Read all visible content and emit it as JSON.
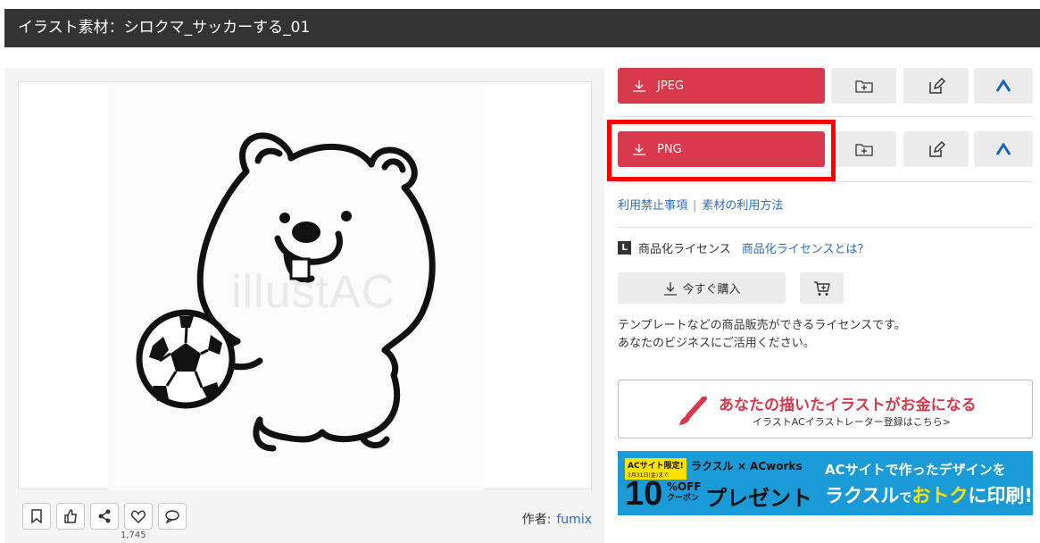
{
  "header": {
    "title": "イラスト素材：シロクマ_サッカーする_01"
  },
  "preview": {
    "watermark": "illustAC"
  },
  "actions": {
    "like_count": "1,745",
    "author_label": "作者:",
    "author_name": "fumix"
  },
  "downloads": [
    {
      "label": "JPEG"
    },
    {
      "label": "PNG",
      "highlighted": true
    }
  ],
  "links": {
    "prohibited": "利用禁止事項",
    "separator": "|",
    "usage": "素材の利用方法"
  },
  "license": {
    "badge": "L",
    "title": "商品化ライセンス",
    "link": "商品化ライセンスとは？",
    "buy_label": "今すぐ購入",
    "desc_line1": "テンプレートなどの商品販売ができるライセンスです。",
    "desc_line2": "あなたのビジネスにご活用ください。"
  },
  "creator_promo": {
    "title": "あなたの描いたイラストがお金になる",
    "subtitle": "イラストACイラストレーター登録はこちら>"
  },
  "banner": {
    "tag": "ACサイト限定!",
    "tag_date": "3月31日(金)まで",
    "logos": "ラクスル × ACworks",
    "big_num": "10",
    "off_line1": "%OFF",
    "off_line2": "クーポン",
    "present": "プレゼント",
    "right_line1": "ACサイトで作ったデザインを",
    "right_line2_a": "ラクスル",
    "right_line2_b": "で",
    "right_line2_c": "おトク",
    "right_line2_d": "に印刷!"
  },
  "colors": {
    "accent": "#d8394c",
    "link": "#2b6cc4",
    "header_bg": "#333333",
    "highlight": "#ff0000",
    "banner_bg": "#1a9bd7"
  }
}
